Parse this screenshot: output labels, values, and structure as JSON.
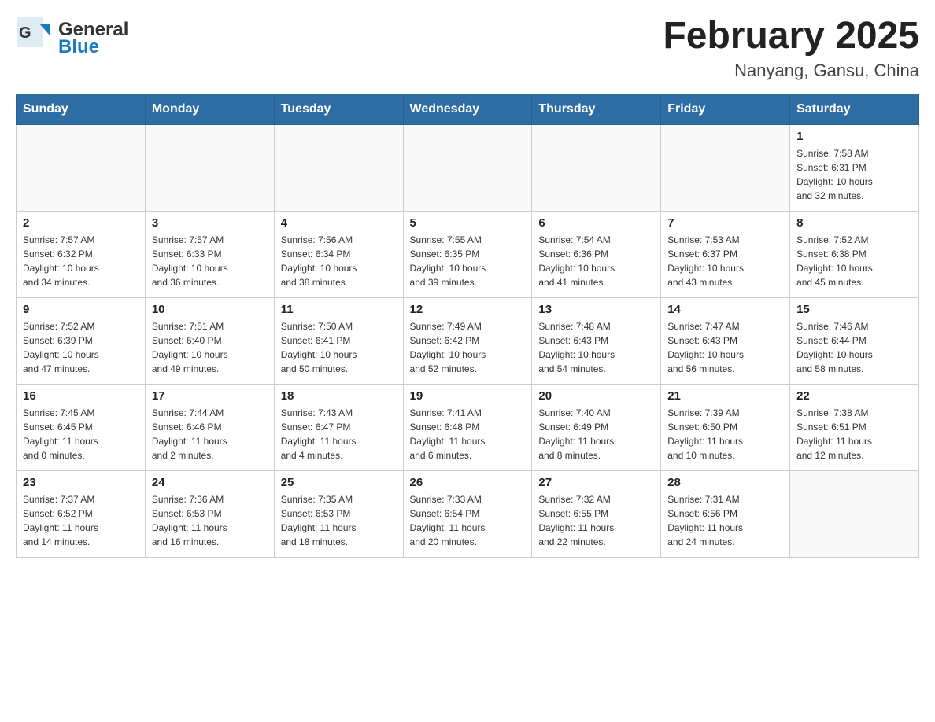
{
  "header": {
    "logo_general": "General",
    "logo_blue": "Blue",
    "title": "February 2025",
    "subtitle": "Nanyang, Gansu, China"
  },
  "weekdays": [
    "Sunday",
    "Monday",
    "Tuesday",
    "Wednesday",
    "Thursday",
    "Friday",
    "Saturday"
  ],
  "weeks": [
    [
      {
        "day": "",
        "info": ""
      },
      {
        "day": "",
        "info": ""
      },
      {
        "day": "",
        "info": ""
      },
      {
        "day": "",
        "info": ""
      },
      {
        "day": "",
        "info": ""
      },
      {
        "day": "",
        "info": ""
      },
      {
        "day": "1",
        "info": "Sunrise: 7:58 AM\nSunset: 6:31 PM\nDaylight: 10 hours\nand 32 minutes."
      }
    ],
    [
      {
        "day": "2",
        "info": "Sunrise: 7:57 AM\nSunset: 6:32 PM\nDaylight: 10 hours\nand 34 minutes."
      },
      {
        "day": "3",
        "info": "Sunrise: 7:57 AM\nSunset: 6:33 PM\nDaylight: 10 hours\nand 36 minutes."
      },
      {
        "day": "4",
        "info": "Sunrise: 7:56 AM\nSunset: 6:34 PM\nDaylight: 10 hours\nand 38 minutes."
      },
      {
        "day": "5",
        "info": "Sunrise: 7:55 AM\nSunset: 6:35 PM\nDaylight: 10 hours\nand 39 minutes."
      },
      {
        "day": "6",
        "info": "Sunrise: 7:54 AM\nSunset: 6:36 PM\nDaylight: 10 hours\nand 41 minutes."
      },
      {
        "day": "7",
        "info": "Sunrise: 7:53 AM\nSunset: 6:37 PM\nDaylight: 10 hours\nand 43 minutes."
      },
      {
        "day": "8",
        "info": "Sunrise: 7:52 AM\nSunset: 6:38 PM\nDaylight: 10 hours\nand 45 minutes."
      }
    ],
    [
      {
        "day": "9",
        "info": "Sunrise: 7:52 AM\nSunset: 6:39 PM\nDaylight: 10 hours\nand 47 minutes."
      },
      {
        "day": "10",
        "info": "Sunrise: 7:51 AM\nSunset: 6:40 PM\nDaylight: 10 hours\nand 49 minutes."
      },
      {
        "day": "11",
        "info": "Sunrise: 7:50 AM\nSunset: 6:41 PM\nDaylight: 10 hours\nand 50 minutes."
      },
      {
        "day": "12",
        "info": "Sunrise: 7:49 AM\nSunset: 6:42 PM\nDaylight: 10 hours\nand 52 minutes."
      },
      {
        "day": "13",
        "info": "Sunrise: 7:48 AM\nSunset: 6:43 PM\nDaylight: 10 hours\nand 54 minutes."
      },
      {
        "day": "14",
        "info": "Sunrise: 7:47 AM\nSunset: 6:43 PM\nDaylight: 10 hours\nand 56 minutes."
      },
      {
        "day": "15",
        "info": "Sunrise: 7:46 AM\nSunset: 6:44 PM\nDaylight: 10 hours\nand 58 minutes."
      }
    ],
    [
      {
        "day": "16",
        "info": "Sunrise: 7:45 AM\nSunset: 6:45 PM\nDaylight: 11 hours\nand 0 minutes."
      },
      {
        "day": "17",
        "info": "Sunrise: 7:44 AM\nSunset: 6:46 PM\nDaylight: 11 hours\nand 2 minutes."
      },
      {
        "day": "18",
        "info": "Sunrise: 7:43 AM\nSunset: 6:47 PM\nDaylight: 11 hours\nand 4 minutes."
      },
      {
        "day": "19",
        "info": "Sunrise: 7:41 AM\nSunset: 6:48 PM\nDaylight: 11 hours\nand 6 minutes."
      },
      {
        "day": "20",
        "info": "Sunrise: 7:40 AM\nSunset: 6:49 PM\nDaylight: 11 hours\nand 8 minutes."
      },
      {
        "day": "21",
        "info": "Sunrise: 7:39 AM\nSunset: 6:50 PM\nDaylight: 11 hours\nand 10 minutes."
      },
      {
        "day": "22",
        "info": "Sunrise: 7:38 AM\nSunset: 6:51 PM\nDaylight: 11 hours\nand 12 minutes."
      }
    ],
    [
      {
        "day": "23",
        "info": "Sunrise: 7:37 AM\nSunset: 6:52 PM\nDaylight: 11 hours\nand 14 minutes."
      },
      {
        "day": "24",
        "info": "Sunrise: 7:36 AM\nSunset: 6:53 PM\nDaylight: 11 hours\nand 16 minutes."
      },
      {
        "day": "25",
        "info": "Sunrise: 7:35 AM\nSunset: 6:53 PM\nDaylight: 11 hours\nand 18 minutes."
      },
      {
        "day": "26",
        "info": "Sunrise: 7:33 AM\nSunset: 6:54 PM\nDaylight: 11 hours\nand 20 minutes."
      },
      {
        "day": "27",
        "info": "Sunrise: 7:32 AM\nSunset: 6:55 PM\nDaylight: 11 hours\nand 22 minutes."
      },
      {
        "day": "28",
        "info": "Sunrise: 7:31 AM\nSunset: 6:56 PM\nDaylight: 11 hours\nand 24 minutes."
      },
      {
        "day": "",
        "info": ""
      }
    ]
  ]
}
